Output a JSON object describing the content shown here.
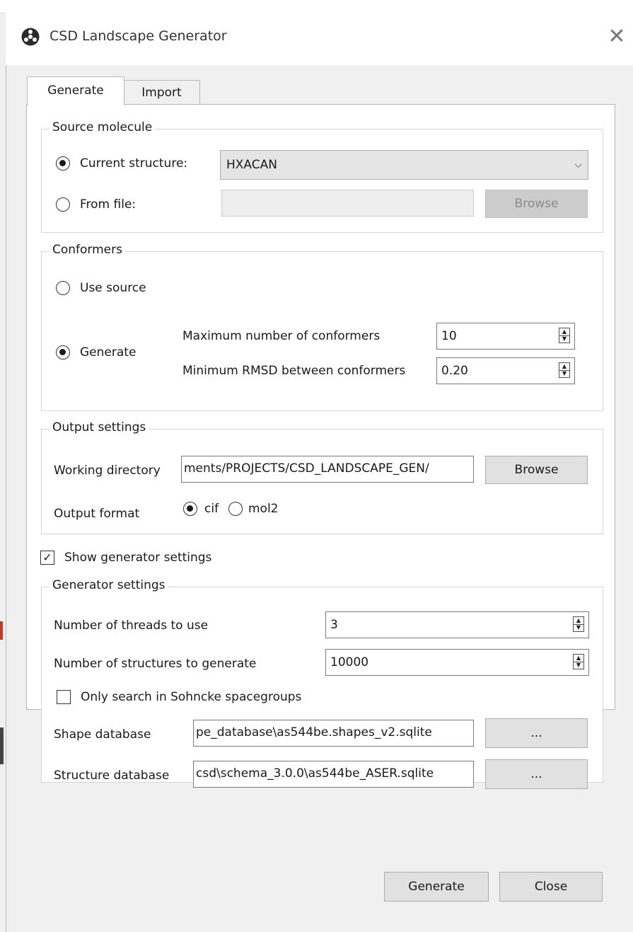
{
  "window": {
    "title": "CSD Landscape Generator",
    "app_icon": "biohazard-style-app-icon",
    "close_icon": "close-icon"
  },
  "tabs": [
    {
      "label": "Generate",
      "active": true
    },
    {
      "label": "Import",
      "active": false
    }
  ],
  "source_molecule": {
    "legend": "Source molecule",
    "current_structure_label": "Current structure:",
    "current_structure_selected": true,
    "current_structure_value": "HXACAN",
    "from_file_label": "From file:",
    "from_file_selected": false,
    "from_file_value": "",
    "browse_label": "Browse"
  },
  "conformers": {
    "legend": "Conformers",
    "use_source_label": "Use source",
    "use_source_selected": false,
    "generate_label": "Generate",
    "generate_selected": true,
    "max_conformers_label": "Maximum number of conformers",
    "max_conformers_value": "10",
    "min_rmsd_label": "Minimum RMSD between conformers",
    "min_rmsd_value": "0.20"
  },
  "output_settings": {
    "legend": "Output settings",
    "working_directory_label": "Working directory",
    "working_directory_value": "ments/PROJECTS/CSD_LANDSCAPE_GEN/",
    "browse_label": "Browse",
    "output_format_label": "Output format",
    "format_cif_label": "cif",
    "format_cif_selected": true,
    "format_mol2_label": "mol2",
    "format_mol2_selected": false
  },
  "show_generator_settings": {
    "label": "Show generator settings",
    "checked": true
  },
  "generator_settings": {
    "legend": "Generator settings",
    "threads_label": "Number of threads to use",
    "threads_value": "3",
    "structures_label": "Number of structures to generate",
    "structures_value": "10000",
    "sohncke_label": "Only search in Sohncke spacegroups",
    "sohncke_checked": false,
    "shape_db_label": "Shape database",
    "shape_db_value": "pe_database\\as544be.shapes_v2.sqlite",
    "shape_db_button": "...",
    "structure_db_label": "Structure database",
    "structure_db_value": "csd\\schema_3.0.0\\as544be_ASER.sqlite",
    "structure_db_button": "..."
  },
  "footer": {
    "generate_label": "Generate",
    "close_label": "Close"
  }
}
